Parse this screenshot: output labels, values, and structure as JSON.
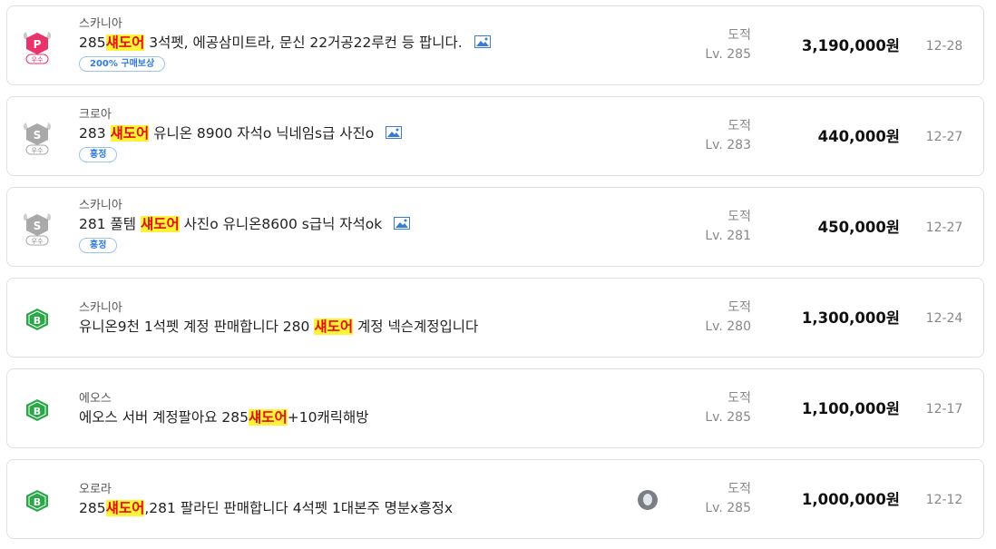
{
  "listings": [
    {
      "badge": {
        "type": "premium-seller-icon",
        "letter": "P",
        "label": "우수",
        "color": "#e8336b"
      },
      "server": "스카니아",
      "title_before": "285",
      "highlight": "섀도어",
      "title_after": " 3석펫, 에공삼미트라, 문신 22거공22루컨 등 팝니다.",
      "has_image_icon": true,
      "tag": "200% 구매보상",
      "job": "도적",
      "level": "Lv. 285",
      "price": "3,190,000원",
      "date": "12-28"
    },
    {
      "badge": {
        "type": "silver-seller-icon",
        "letter": "S",
        "label": "우수",
        "color": "#9a9a9a"
      },
      "server": "크로아",
      "title_before": "283 ",
      "highlight": "섀도어",
      "title_after": " 유니온 8900 자석o 닉네임s급 사진o",
      "has_image_icon": true,
      "tag": "흥정",
      "job": "도적",
      "level": "Lv. 283",
      "price": "440,000원",
      "date": "12-27"
    },
    {
      "badge": {
        "type": "silver-seller-icon",
        "letter": "S",
        "label": "우수",
        "color": "#9a9a9a"
      },
      "server": "스카니아",
      "title_before": "281 풀템 ",
      "highlight": "섀도어",
      "title_after": " 사진o 유니온8600 s급닉 자석ok",
      "has_image_icon": true,
      "tag": "흥정",
      "job": "도적",
      "level": "Lv. 281",
      "price": "450,000원",
      "date": "12-27"
    },
    {
      "badge": {
        "type": "bronze-seller-icon",
        "letter": "B",
        "label": "",
        "color": "#2aa847"
      },
      "server": "스카니아",
      "title_before": "유니온9천 1석펫 계정 판매합니다 280 ",
      "highlight": "섀도어",
      "title_after": " 계정 넥슨계정입니다",
      "has_image_icon": false,
      "tag": "",
      "job": "도적",
      "level": "Lv. 280",
      "price": "1,300,000원",
      "date": "12-24"
    },
    {
      "badge": {
        "type": "bronze-seller-icon",
        "letter": "B",
        "label": "",
        "color": "#2aa847"
      },
      "server": "에오스",
      "title_before": "에오스 서버 계정팔아요 285",
      "highlight": "섀도어",
      "title_after": "+10캐릭해방",
      "has_image_icon": false,
      "tag": "",
      "job": "도적",
      "level": "Lv. 285",
      "price": "1,100,000원",
      "date": "12-17"
    },
    {
      "badge": {
        "type": "bronze-seller-icon",
        "letter": "B",
        "label": "",
        "color": "#2aa847"
      },
      "server": "오로라",
      "title_before": "285",
      "highlight": "섀도어",
      "title_after": ",281 팔라딘 판매합니다 4석펫 1대본주 명분x흥정x",
      "has_image_icon": false,
      "has_avatar": true,
      "tag": "",
      "job": "도적",
      "level": "Lv. 285",
      "price": "1,000,000원",
      "date": "12-12"
    }
  ]
}
